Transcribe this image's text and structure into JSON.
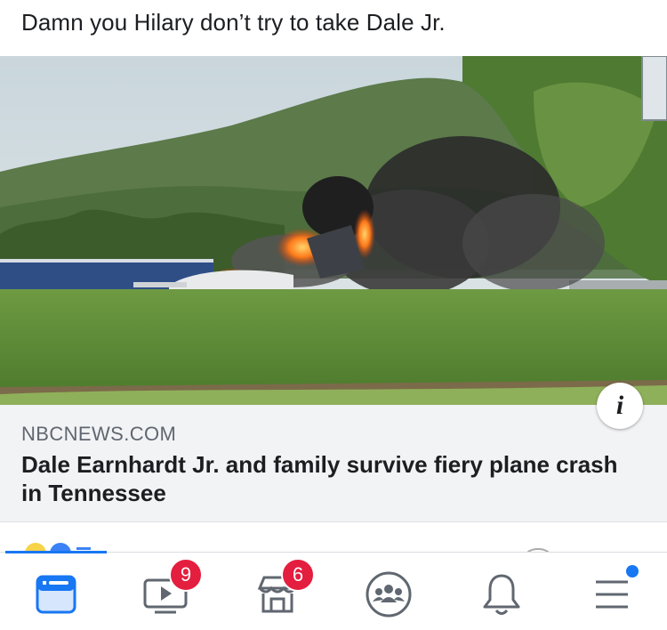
{
  "post": {
    "text": "Damn you Hilary don’t try to take Dale Jr."
  },
  "link": {
    "domain": "NBCNEWS.COM",
    "headline": "Dale Earnhardt Jr. and family survive fiery plane crash in Tennessee",
    "info_glyph": "i"
  },
  "tabbar": {
    "tabs": [
      {
        "name": "news-feed",
        "icon": "news-feed-icon",
        "active": true
      },
      {
        "name": "watch",
        "icon": "watch-icon",
        "badge": "9"
      },
      {
        "name": "marketplace",
        "icon": "marketplace-icon",
        "badge": "6"
      },
      {
        "name": "groups",
        "icon": "groups-icon"
      },
      {
        "name": "notifications",
        "icon": "bell-icon"
      },
      {
        "name": "menu",
        "icon": "menu-icon",
        "dot": true
      }
    ]
  },
  "colors": {
    "accent": "#1877f2",
    "badge": "#e41e3f",
    "icon_inactive": "#606770"
  }
}
